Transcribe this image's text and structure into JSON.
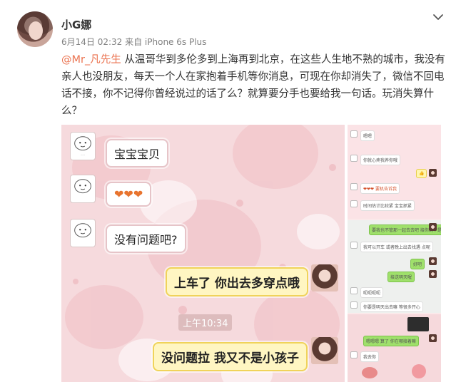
{
  "post": {
    "user_name": "小G娜",
    "meta": "6月14日 02:32 来自 iPhone 6s Plus",
    "mention": "@Mr_凡先生",
    "body": " 从温哥华到多伦多到上海再到北京，在这些人生地不熟的城市，我没有亲人也没朋友，每天一个人在家抱着手机等你消息，可现在你却消失了，微信不回电话不接，你不记得你曾经说过的话了么？就算要分手也要给我一句话。玩消失算什么？"
  },
  "chat": {
    "messages": [
      {
        "text": "宝宝宝贝"
      },
      {
        "text": "❤❤❤"
      },
      {
        "text": "没有问题吧?"
      },
      {
        "text": "上车了 你出去多穿点哦"
      },
      {
        "text": "没问题拉 我又不是小孩子"
      }
    ],
    "timestamp": "上午10:34"
  },
  "thumbs": {
    "items": [
      {
        "text": "嗯嗯"
      },
      {
        "text": "你就心疼我养你哦"
      },
      {
        "text": "❤❤❤ 要机告诉我"
      },
      {
        "text": "时间估计比较紧 宝宝抓紧"
      },
      {
        "text": "要我也不管那一起去去吧 接你到不是"
      },
      {
        "text": "我可以开车 或者晚上出去找遇 点呢"
      },
      {
        "text": "好吧"
      },
      {
        "text": "接送明天喔"
      },
      {
        "text": "呃呃呃呃"
      },
      {
        "text": "你要是明天出去嘛 等很多开心"
      },
      {
        "text": "嗯嗯嗯 算了 你在哪接着嘛"
      },
      {
        "text": "我去你"
      }
    ]
  },
  "colors": {
    "mention": "#eb7350",
    "meta": "#808080",
    "pink_bg": "#f6dadd",
    "yellow_bubble": "#fff6c2"
  }
}
